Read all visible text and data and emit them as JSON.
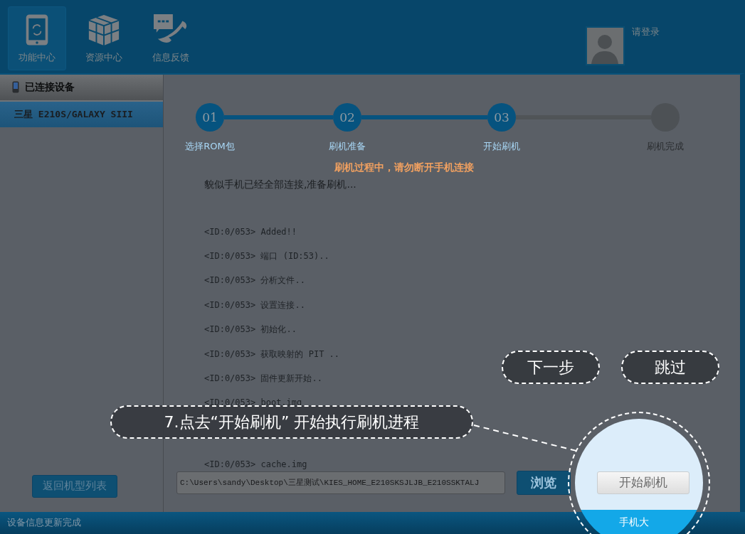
{
  "toolbar": {
    "items": [
      {
        "label": "功能中心",
        "selected": true
      },
      {
        "label": "资源中心",
        "selected": false
      },
      {
        "label": "信息反馈",
        "selected": false
      }
    ]
  },
  "user": {
    "label": "请登录"
  },
  "sidebar": {
    "title": "已连接设备",
    "devices": [
      {
        "label": "三星 E210S/GALAXY SIII",
        "selected": true
      }
    ],
    "back_button": "返回机型列表"
  },
  "steps": [
    {
      "number": "01",
      "label": "选择ROM包",
      "completed": true
    },
    {
      "number": "02",
      "label": "刷机准备",
      "completed": true
    },
    {
      "number": "03",
      "label": "开始刷机",
      "completed": true
    },
    {
      "label": "刷机完成",
      "completed": false
    }
  ],
  "warning": "刷机过程中，请勿断开手机连接",
  "status_line": "貌似手机已经全部连接,准备刷机...",
  "log": [
    "<ID:0/053> Added!!",
    "<ID:0/053> 端口 (ID:53)..",
    "<ID:0/053> 分析文件..",
    "<ID:0/053> 设置连接..",
    "<ID:0/053> 初始化..",
    "<ID:0/053> 获取映射的 PIT ..",
    "<ID:0/053> 固件更新开始..",
    "<ID:0/053> boot.img",
    "<ID:0/053> cache.img"
  ],
  "path_field": {
    "value": "C:\\Users\\sandy\\Desktop\\三星测试\\KIES_HOME_E210SKSJLJB_E210SSKTALJ"
  },
  "browse_button": "浏览",
  "start_button": "开始刷机",
  "status_bar": {
    "left": "设备信息更新完成",
    "right": "手机大"
  },
  "tutorial": {
    "callout": "7.点去“开始刷机” 开始执行刷机进程",
    "next_button": "下一步",
    "skip_button": "跳过"
  }
}
